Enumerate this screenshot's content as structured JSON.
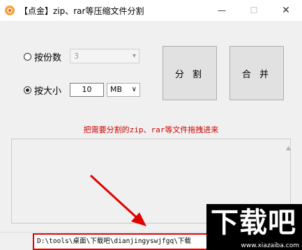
{
  "window": {
    "title": "【点金】zip、rar等压缩文件分割",
    "min_symbol": "—",
    "max_symbol": "☐",
    "close_symbol": "✕"
  },
  "options": {
    "by_count_label": "按份数",
    "by_count_value": "3",
    "by_size_label": "按大小",
    "size_value": "10",
    "unit_value": "MB"
  },
  "buttons": {
    "split": "分 割",
    "merge": "合 并"
  },
  "hint": "把需要分割的zip、rar等文件拖拽进来",
  "status": {
    "path": "D:\\tools\\桌面\\下载吧\\dianjingyswjfgq\\下载"
  },
  "watermark": {
    "main": "下载吧",
    "url": "www.xiazaiba.com"
  },
  "colors": {
    "accent_red": "#e00000",
    "hint_red": "#d00000"
  }
}
